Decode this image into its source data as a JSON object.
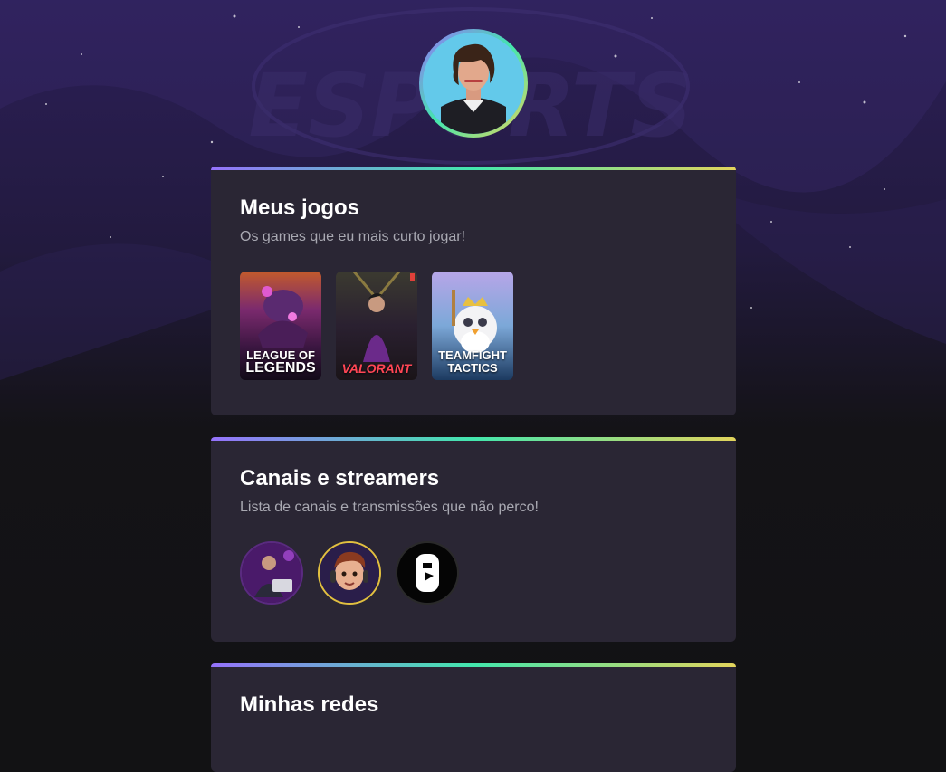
{
  "profile": {
    "avatar_alt": "Foto de perfil"
  },
  "games_section": {
    "title": "Meus jogos",
    "subtitle": "Os games que eu mais curto jogar!",
    "games": [
      {
        "name_line1": "LEAGUE OF",
        "name_line2": "LEGENDS"
      },
      {
        "name_line1": "VALORANT",
        "name_line2": ""
      },
      {
        "name_line1": "TEAMFIGHT",
        "name_line2": "TACTICS"
      }
    ]
  },
  "streamers_section": {
    "title": "Canais e streamers",
    "subtitle": "Lista de canais e transmissões que não perco!"
  },
  "networks_section": {
    "title": "Minhas redes"
  },
  "colors": {
    "background": "#121214",
    "card": "#2a2634",
    "gradient_start": "#9572fc",
    "gradient_mid": "#43e7ad",
    "gradient_end": "#e2d45c"
  }
}
